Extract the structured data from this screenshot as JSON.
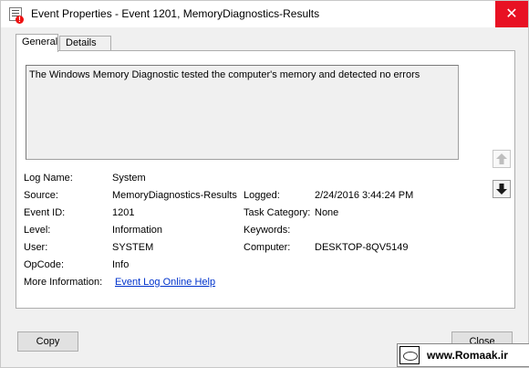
{
  "window": {
    "title": "Event Properties - Event 1201, MemoryDiagnostics-Results",
    "close_glyph": "✕"
  },
  "tabs": [
    {
      "label": "General",
      "active": true
    },
    {
      "label": "Details",
      "active": false
    }
  ],
  "description": "The Windows Memory Diagnostic tested the computer's memory and detected no errors",
  "fields": {
    "log_name": {
      "label": "Log Name:",
      "value": "System"
    },
    "source": {
      "label": "Source:",
      "value": "MemoryDiagnostics-Results"
    },
    "event_id": {
      "label": "Event ID:",
      "value": "1201"
    },
    "level": {
      "label": "Level:",
      "value": "Information"
    },
    "user": {
      "label": "User:",
      "value": "SYSTEM"
    },
    "opcode": {
      "label": "OpCode:",
      "value": "Info"
    },
    "more_info": {
      "label": "More Information:",
      "value": "Event Log Online Help"
    },
    "logged": {
      "label": "Logged:",
      "value": "2/24/2016 3:44:24 PM"
    },
    "task_category": {
      "label": "Task Category:",
      "value": "None"
    },
    "keywords": {
      "label": "Keywords:",
      "value": ""
    },
    "computer": {
      "label": "Computer:",
      "value": "DESKTOP-8QV5149"
    }
  },
  "buttons": {
    "copy": "Copy",
    "close": "Close"
  },
  "icons": {
    "up": "arrow-up-icon",
    "down": "arrow-down-icon"
  },
  "watermark": {
    "text": "www.Romaak.ir"
  }
}
